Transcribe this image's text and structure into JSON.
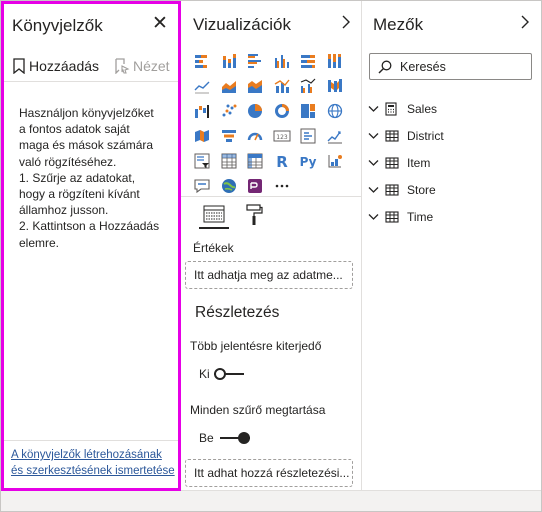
{
  "bookmarks": {
    "title": "Könyvjelzők",
    "close_icon": "close-icon",
    "add_label": "Hozzáadás",
    "view_label": "Nézet",
    "help_text": "Használjon könyvjelzőket\na fontos adatok saját\nmaga és mások számára\nvaló rögzítéséhez.\n1. Szűrje az adatokat,\nhogy a rögzíteni kívánt\nállamhoz jusson.\n2. Kattintson a Hozzáadás\nelemre.",
    "footer_link": "A könyvjelzők létrehozásának és szerkesztésének ismertetése",
    "border_color": "#e600e6"
  },
  "visualizations": {
    "title": "Vizualizációk",
    "values_label": "Értékek",
    "values_placeholder": "Itt adhatja meg az adatme...",
    "drillthrough_title": "Részletezés",
    "cross_report_label": "Több jelentésre kiterjedő",
    "cross_report_state": "Ki",
    "keep_filters_label": "Minden szűrő megtartása",
    "keep_filters_state": "Be",
    "drillthrough_placeholder": "Itt adhat hozzá részletezési...",
    "icons": [
      "stacked-bar-icon",
      "stacked-column-icon",
      "clustered-bar-icon",
      "clustered-column-icon",
      "100-stacked-bar-icon",
      "100-stacked-column-icon",
      "line-chart-icon",
      "area-chart-icon",
      "stacked-area-icon",
      "line-column-icon",
      "line-clustered-column-icon",
      "ribbon-chart-icon",
      "waterfall-icon",
      "scatter-icon",
      "pie-icon",
      "donut-icon",
      "treemap-icon",
      "map-icon",
      "filled-map-icon",
      "funnel-icon",
      "gauge-icon",
      "card-icon",
      "multi-row-card-icon",
      "kpi-icon",
      "slicer-icon",
      "table-icon",
      "matrix-icon",
      "r-visual-icon",
      "python-visual-icon",
      "key-influencers-icon",
      "qa-icon",
      "arcgis-icon",
      "power-apps-icon",
      "more-visuals-icon"
    ]
  },
  "fields": {
    "title": "Mezők",
    "search_placeholder": "Keresés",
    "tables": [
      "Sales",
      "District",
      "Item",
      "Store",
      "Time"
    ]
  },
  "colors": {
    "accent_blue": "#3a78c5",
    "accent_orange": "#e97c1f",
    "text": "#252423"
  }
}
